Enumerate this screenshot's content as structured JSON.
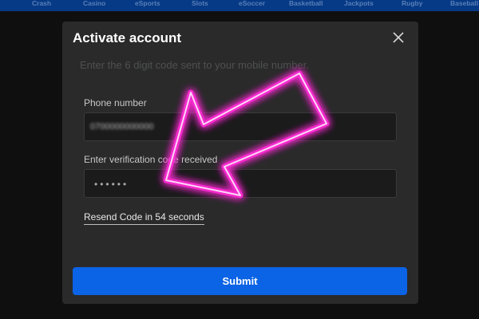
{
  "topnav": {
    "items": [
      "Crash",
      "Casino",
      "eSports",
      "Slots",
      "eSoccer",
      "Basketball",
      "Jackpots",
      "Rugby",
      "Baseball"
    ]
  },
  "modal": {
    "title": "Activate account",
    "instruction": "Enter the 6 digit code sent to your mobile number.",
    "phone_label": "Phone number",
    "phone_value": "0700000000000",
    "code_label": "Enter verification code received",
    "code_value": "••••••",
    "resend_text": "Resend Code in 54 seconds",
    "submit_label": "Submit"
  },
  "overlay": {
    "arrow_color": "#ff2bd6",
    "icon": "neon-arrow-icon"
  },
  "colors": {
    "accent": "#0b63e5",
    "nav_bg": "#063a86",
    "modal_bg": "#2a2a2b"
  }
}
